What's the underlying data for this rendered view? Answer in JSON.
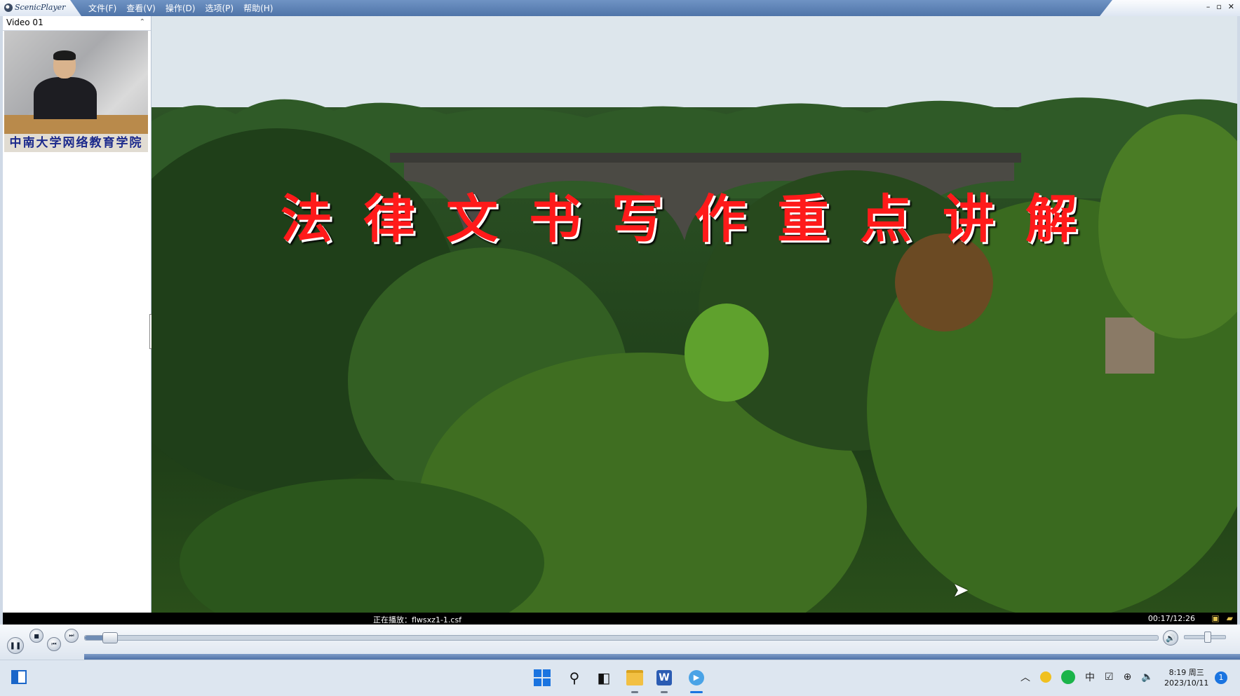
{
  "app": {
    "name": "ScenicPlayer",
    "menu": [
      "文件(F)",
      "查看(V)",
      "操作(D)",
      "选项(P)",
      "帮助(H)"
    ],
    "window_controls": [
      "–",
      "▫",
      "✕"
    ]
  },
  "left_panel": {
    "video_title": "Video 01",
    "collapse_glyph": "⌃",
    "thumbnail_banner": "中南大学网络教育学院"
  },
  "video": {
    "title_overlay": "法律文书写作重点讲解"
  },
  "status_bar": {
    "now_playing": "正在播放：flwsxz1-1.csf",
    "time": "00:17/12:26",
    "icons": [
      "video-settings-icon",
      "open-folder-icon"
    ]
  },
  "controls": {
    "pause_glyph": "❚❚",
    "stop_glyph": "■",
    "prev_glyph": "⏮",
    "next_glyph": "⏭",
    "seek_position": 0.023,
    "volume_glyph": "🔊",
    "volume_level": 0.55
  },
  "taskbar": {
    "apps": [
      "start",
      "search",
      "task-view",
      "file-explorer",
      "word",
      "scenicplayer"
    ],
    "word_letter": "W",
    "tray": {
      "chevron": "︿",
      "ime": "中",
      "clock_time": "8:19 周三",
      "clock_date": "2023/10/11",
      "notification_count": "1"
    }
  },
  "colors": {
    "title_red": "#ff1a1a",
    "chrome_blue": "#4f74a8",
    "accent_blue": "#1a74e0"
  }
}
